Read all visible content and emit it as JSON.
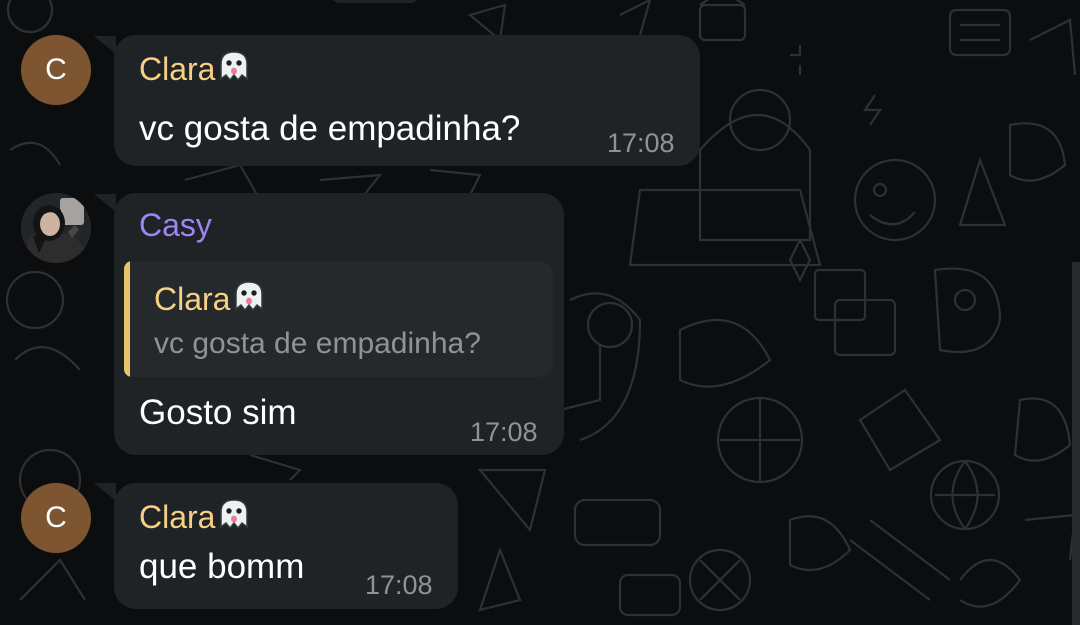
{
  "colors": {
    "background": "#0b0d0f",
    "bubble": "#1f2326",
    "quote_background": "#25292c",
    "clara_name": "#f5d085",
    "casy_name": "#9d86f1",
    "quote_accent": "#e7c36c",
    "timestamp": "#8d9498",
    "avatar_c": "#7d5530"
  },
  "messages": [
    {
      "avatar": {
        "type": "letter",
        "letter": "C"
      },
      "sender": "Clara",
      "sender_emoji": "ghost-emoji",
      "text": "vc gosta de empadinha?",
      "time": "17:08"
    },
    {
      "avatar": {
        "type": "photo",
        "icon": "profile-photo"
      },
      "sender": "Casy",
      "reply": {
        "sender": "Clara",
        "sender_emoji": "ghost-emoji",
        "text": "vc gosta de empadinha?"
      },
      "text": "Gosto sim",
      "time": "17:08"
    },
    {
      "avatar": {
        "type": "letter",
        "letter": "C"
      },
      "sender": "Clara",
      "sender_emoji": "ghost-emoji",
      "text": "que bomm",
      "time": "17:08"
    }
  ]
}
